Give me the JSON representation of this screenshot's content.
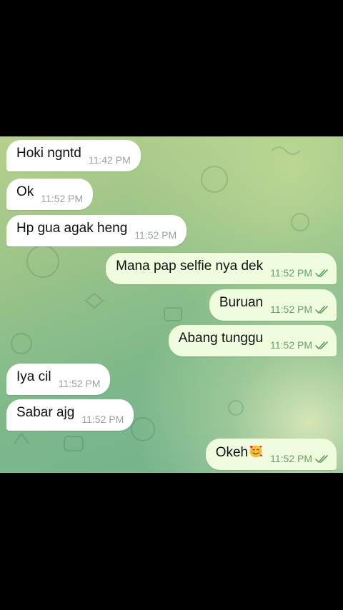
{
  "messages": [
    {
      "dir": "in",
      "text": "Hoki ngntd",
      "time": "11:42 PM"
    },
    {
      "dir": "in",
      "text": "Ok",
      "time": "11:52 PM"
    },
    {
      "dir": "in",
      "text": "Hp gua agak heng",
      "time": "11:52 PM"
    },
    {
      "dir": "out",
      "text": "Mana pap selfie nya dek",
      "time": "11:52 PM",
      "status": "read"
    },
    {
      "dir": "out",
      "text": "Buruan",
      "time": "11:52 PM",
      "status": "read"
    },
    {
      "dir": "out",
      "text": "Abang tunggu",
      "time": "11:52 PM",
      "status": "read"
    },
    {
      "dir": "in",
      "text": "Iya cil",
      "time": "11:52 PM"
    },
    {
      "dir": "in",
      "text": "Sabar ajg",
      "time": "11:52 PM"
    },
    {
      "dir": "out",
      "text": "Okeh",
      "time": "11:52 PM",
      "status": "read",
      "emoji": "smiling-face-with-hearts-icon"
    }
  ],
  "colors": {
    "incoming_bubble": "#ffffff",
    "outgoing_bubble": "#effdde",
    "read_tick": "#5fa05f",
    "wallpaper": "#8cbf8a"
  }
}
